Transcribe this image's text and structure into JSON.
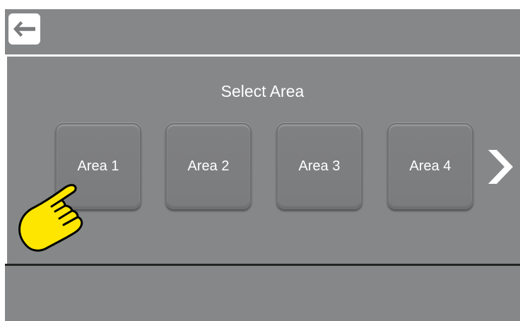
{
  "header": {
    "back_icon": "back-arrow-icon"
  },
  "main": {
    "title": "Select Area",
    "areas": [
      {
        "label": "Area 1"
      },
      {
        "label": "Area 2"
      },
      {
        "label": "Area 3"
      },
      {
        "label": "Area 4"
      }
    ],
    "next_icon": "chevron-right-icon"
  },
  "overlay": {
    "hand_icon": "pointing-hand-icon"
  },
  "colors": {
    "screen_bg": "#868789",
    "text": "#ffffff",
    "divider_light": "#ffffff",
    "divider_dark": "#222222",
    "hand_fill": "#FFE600"
  }
}
